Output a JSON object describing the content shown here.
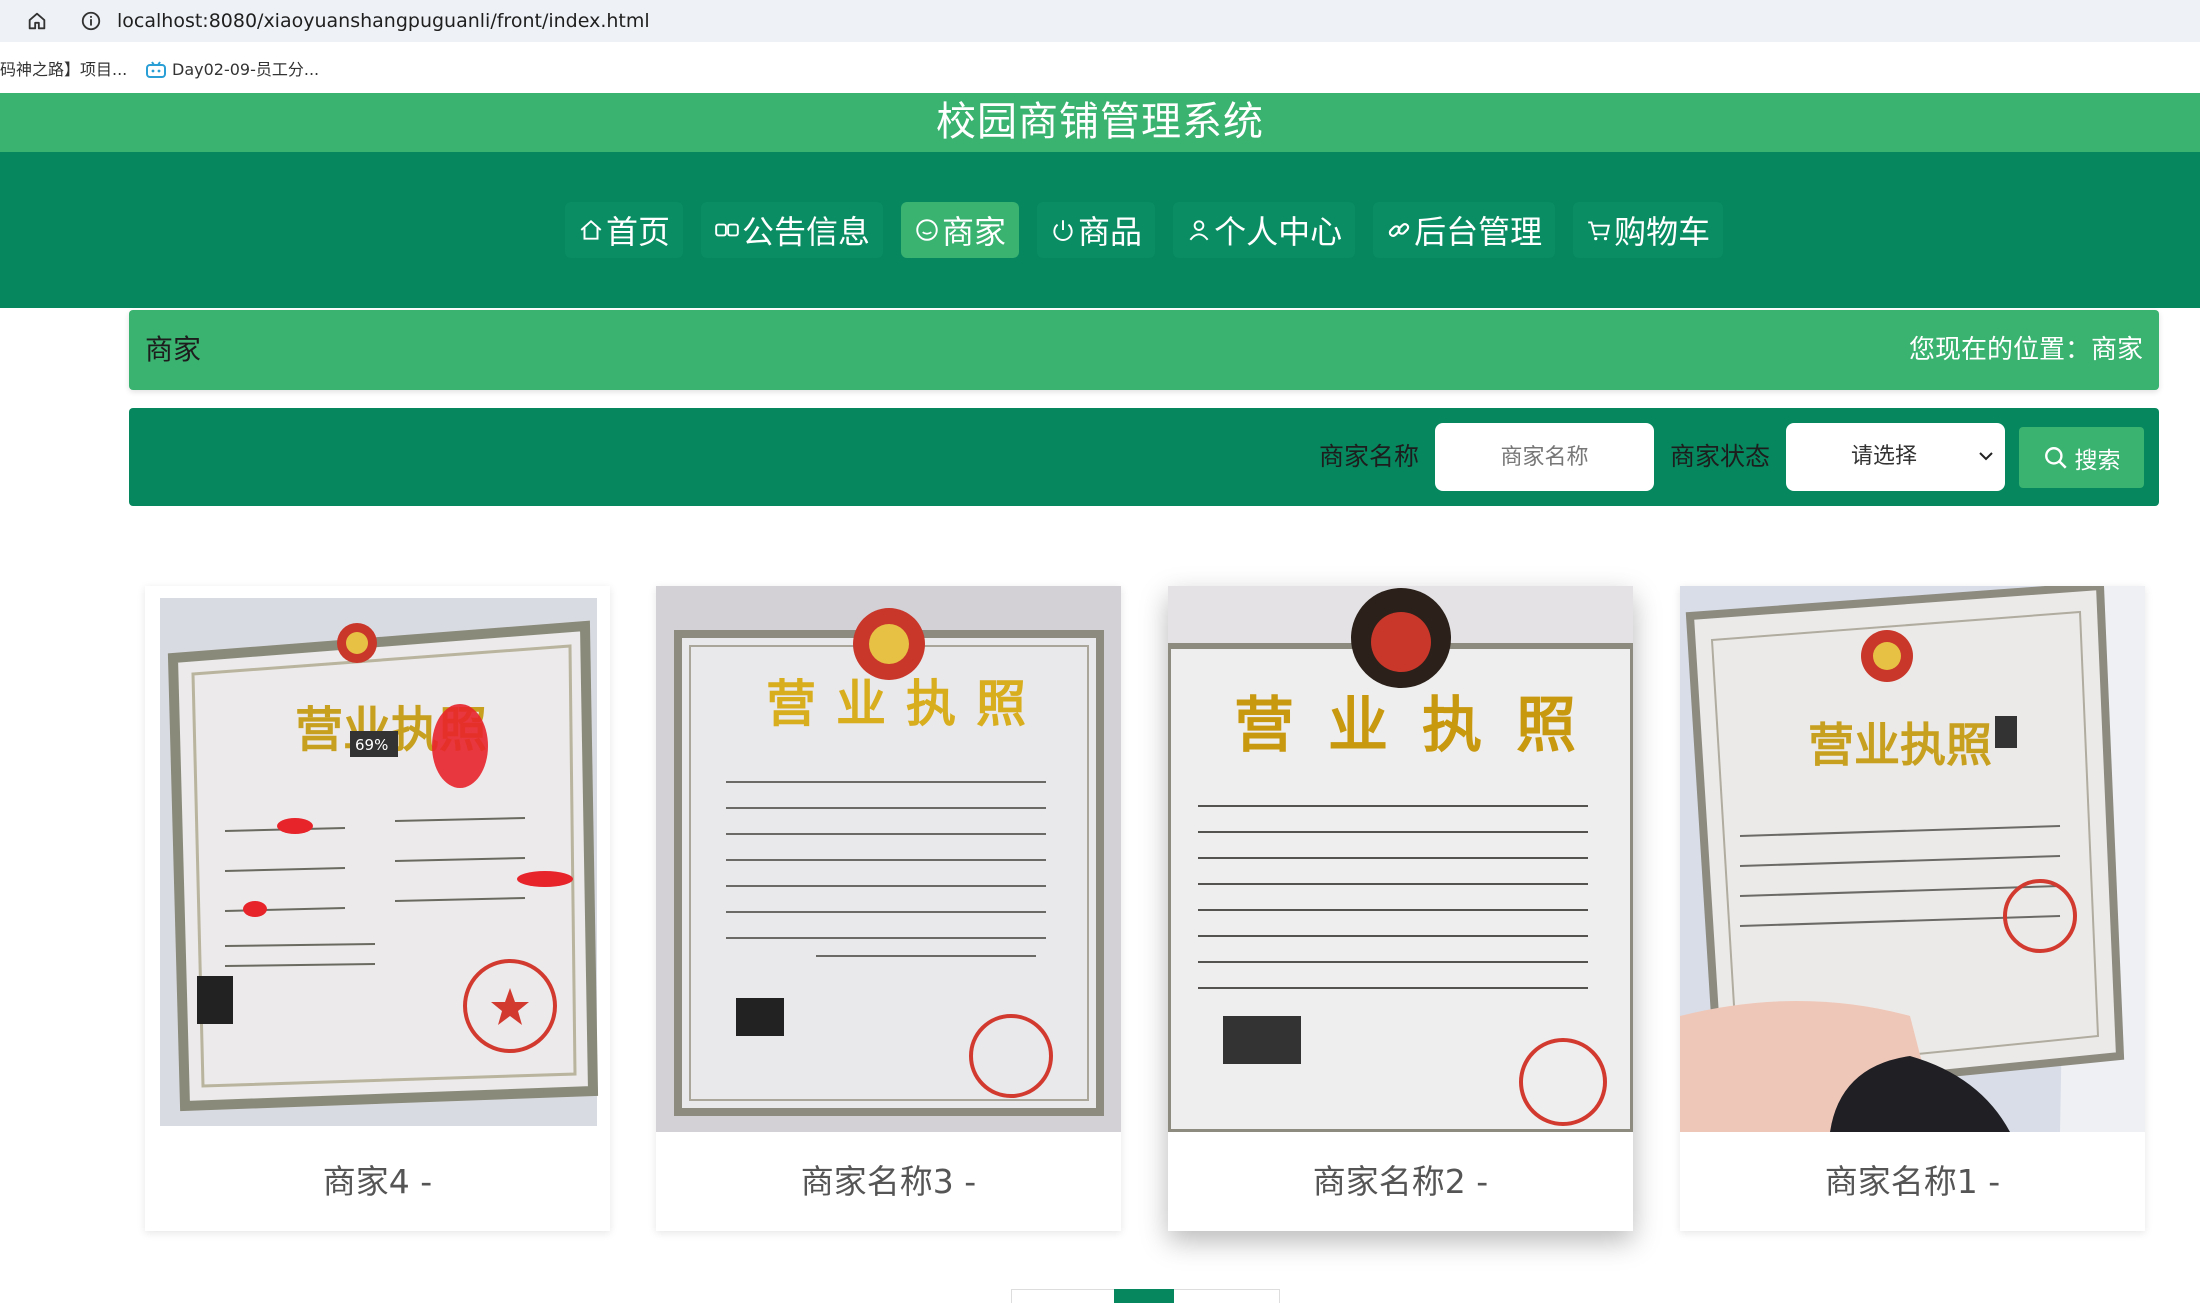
{
  "browser": {
    "url": "localhost:8080/xiaoyuanshangpuguanli/front/index.html",
    "bookmarks": [
      "码神之路】项目...",
      "Day02-09-员工分..."
    ]
  },
  "header": {
    "title": "校园商铺管理系统"
  },
  "nav": {
    "items": [
      {
        "label": "首页",
        "icon": "home-icon"
      },
      {
        "label": "公告信息",
        "icon": "loop-icon"
      },
      {
        "label": "商家",
        "icon": "smile-icon",
        "active": true
      },
      {
        "label": "商品",
        "icon": "power-icon"
      },
      {
        "label": "个人中心",
        "icon": "user-icon"
      },
      {
        "label": "后台管理",
        "icon": "link-icon"
      },
      {
        "label": "购物车",
        "icon": "cart-icon"
      }
    ]
  },
  "breadcrumb": {
    "title": "商家",
    "position": "您现在的位置：商家"
  },
  "search": {
    "name_label": "商家名称",
    "name_placeholder": "商家名称",
    "status_label": "商家状态",
    "status_value": "请选择",
    "button_label": "搜索"
  },
  "cards": [
    {
      "name": "商家4 -",
      "image": "business-license-photo"
    },
    {
      "name": "商家名称3 -",
      "image": "business-license-photo"
    },
    {
      "name": "商家名称2 -",
      "image": "business-license-photo"
    },
    {
      "name": "商家名称1 -",
      "image": "business-license-photo"
    }
  ],
  "license_text": {
    "heading": "营业执照",
    "overlay_percent": "69%"
  },
  "colors": {
    "title_bar": "#3ab270",
    "nav_bar": "#06875e",
    "active_nav": "#3ab270"
  }
}
